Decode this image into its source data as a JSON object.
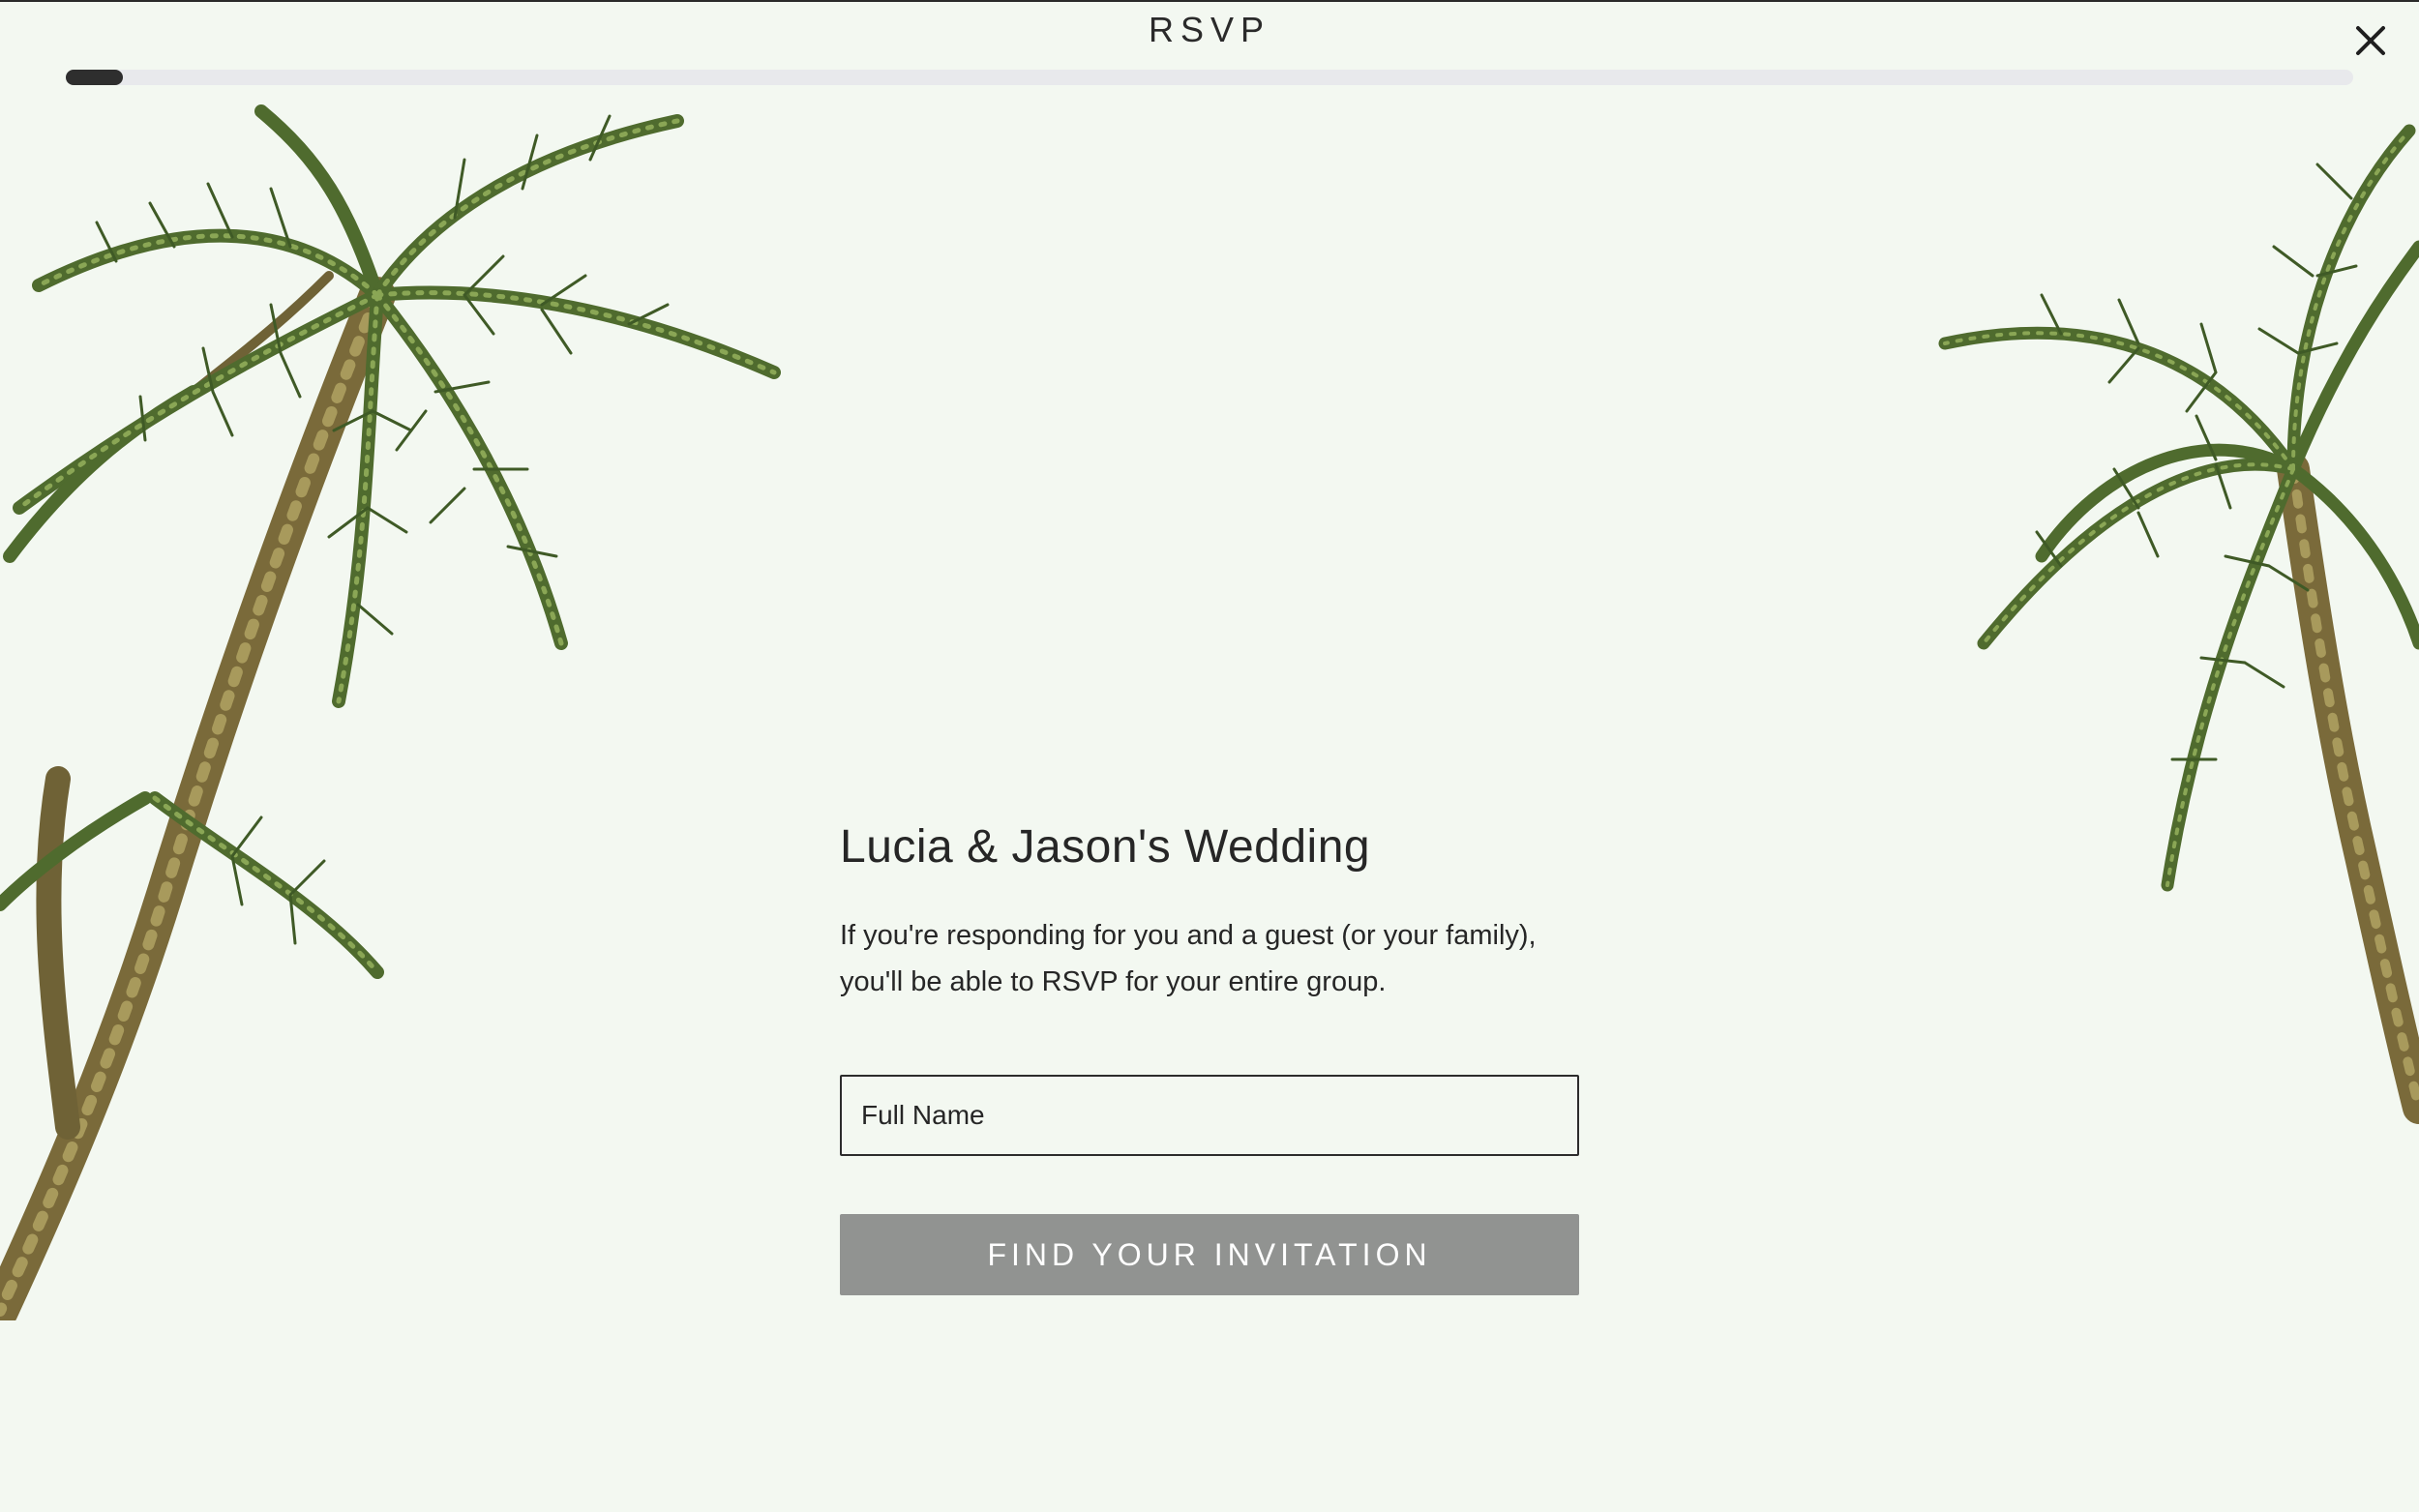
{
  "header": {
    "title": "RSVP",
    "close_icon": "close-icon",
    "progress": 0.025
  },
  "main": {
    "title": "Lucia & Jason's Wedding",
    "description": "If you're responding for you and a guest (or your family), you'll be able to RSVP for your entire group.",
    "name_input": {
      "placeholder": "Full Name",
      "value": ""
    },
    "submit_label": "FIND YOUR INVITATION"
  },
  "colors": {
    "background": "#f3f8f1",
    "button": "#919391",
    "text": "#262626",
    "progress_track": "#e8e9ec",
    "progress_fill": "#2e2e2e"
  }
}
